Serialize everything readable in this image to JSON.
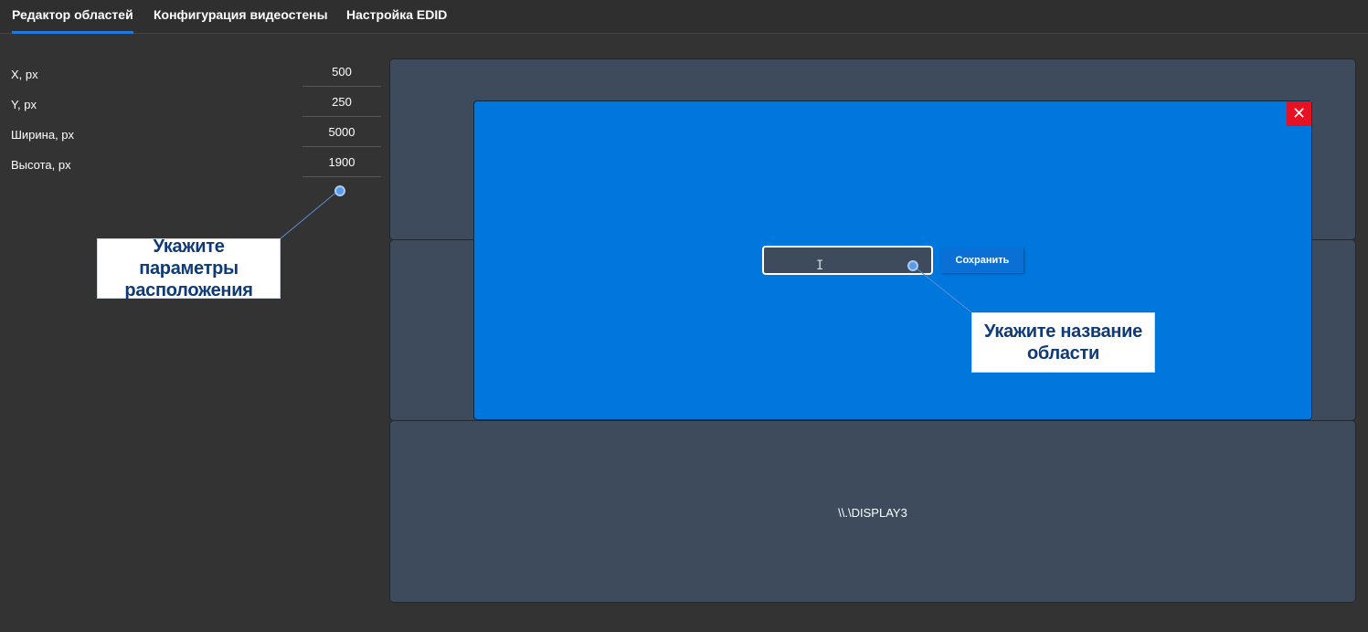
{
  "tabs": [
    {
      "label": "Редактор областей",
      "active": true
    },
    {
      "label": "Конфигурация видеостены",
      "active": false
    },
    {
      "label": "Настройка EDID",
      "active": false
    }
  ],
  "fields": [
    {
      "label": "X, px",
      "value": "500"
    },
    {
      "label": "Y, px",
      "value": "250"
    },
    {
      "label": "Ширина, px",
      "value": "5000"
    },
    {
      "label": "Высота, px",
      "value": "1900"
    }
  ],
  "callouts": {
    "position": "Укажите параметры расположения",
    "name": "Укажите название области"
  },
  "displays": [
    {
      "label": ""
    },
    {
      "label": ""
    },
    {
      "label": "\\\\.\\DISPLAY3"
    }
  ],
  "region": {
    "name_value": "",
    "save_label": "Сохранить",
    "close_glyph": "✕"
  },
  "colors": {
    "background": "#333333",
    "display_card": "#3d4b5c",
    "region": "#0077dd",
    "accent": "#1f7ae0",
    "close": "#e81123",
    "callout_text": "#0f3a78"
  }
}
